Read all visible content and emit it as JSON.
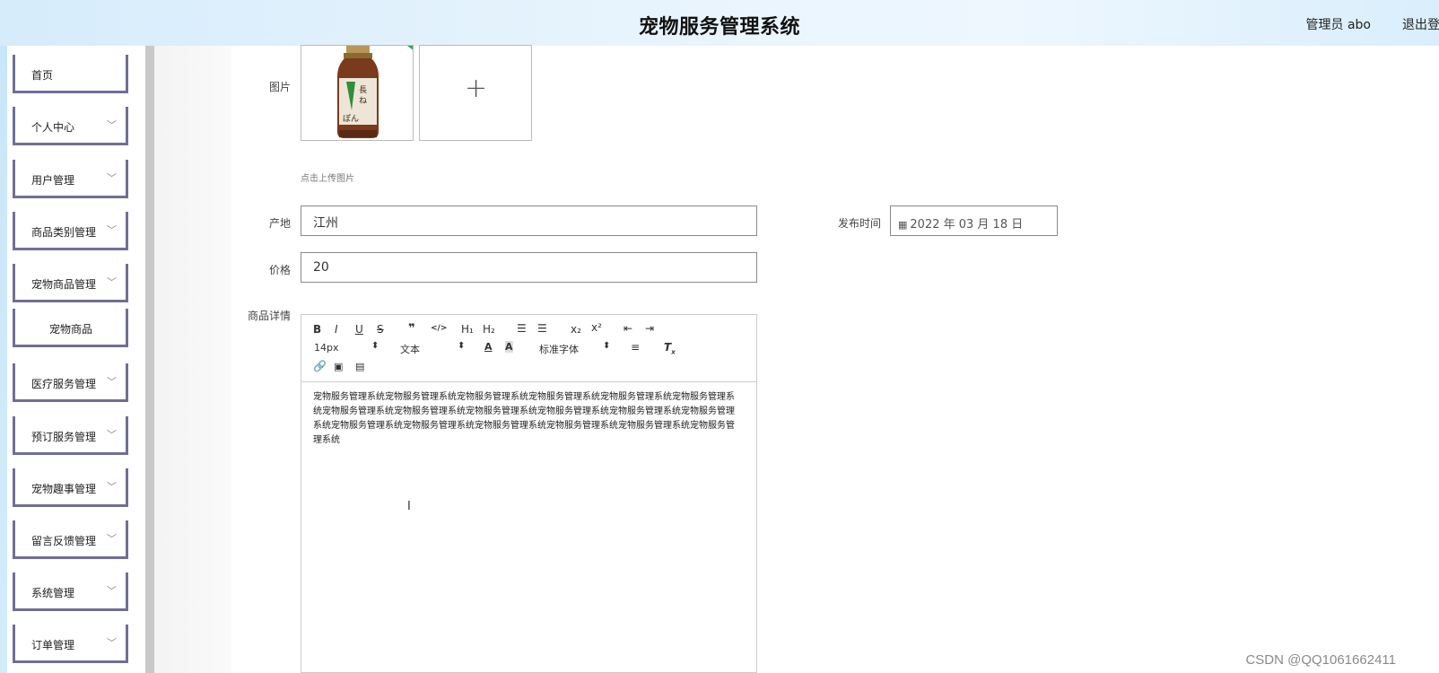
{
  "header": {
    "title": "宠物服务管理系统",
    "user": "管理员 abo",
    "logout": "退出登录"
  },
  "sidebar": {
    "items": [
      {
        "label": "首页",
        "expandable": false
      },
      {
        "label": "个人中心",
        "expandable": true
      },
      {
        "label": "用户管理",
        "expandable": true
      },
      {
        "label": "商品类别管理",
        "expandable": true
      },
      {
        "label": "宠物商品管理",
        "expandable": true
      },
      {
        "label": "宠物商品",
        "expandable": false,
        "sub": true
      },
      {
        "label": "医疗服务管理",
        "expandable": true
      },
      {
        "label": "预订服务管理",
        "expandable": true
      },
      {
        "label": "宠物趣事管理",
        "expandable": true
      },
      {
        "label": "留言反馈管理",
        "expandable": true
      },
      {
        "label": "系统管理",
        "expandable": true
      },
      {
        "label": "订单管理",
        "expandable": true
      }
    ]
  },
  "form": {
    "image_label": "图片",
    "upload_hint": "点击上传图片",
    "origin_label": "产地",
    "origin_value": "江州",
    "publish_label": "发布时间",
    "publish_value": "2022 年 03 月 18 日",
    "price_label": "价格",
    "price_value": "20",
    "detail_label": "商品详情"
  },
  "editor": {
    "font_size": "14px",
    "text_style": "文本",
    "font_family": "标准字体",
    "content": "宠物服务管理系统宠物服务管理系统宠物服务管理系统宠物服务管理系统宠物服务管理系统宠物服务管理系统宠物服务管理系统宠物服务管理系统宠物服务管理系统宠物服务管理系统宠物服务管理系统宠物服务管理系统宠物服务管理系统宠物服务管理系统宠物服务管理系统宠物服务管理系统宠物服务管理系统宠物服务管理系统"
  },
  "watermark": "CSDN @QQ1061662411"
}
